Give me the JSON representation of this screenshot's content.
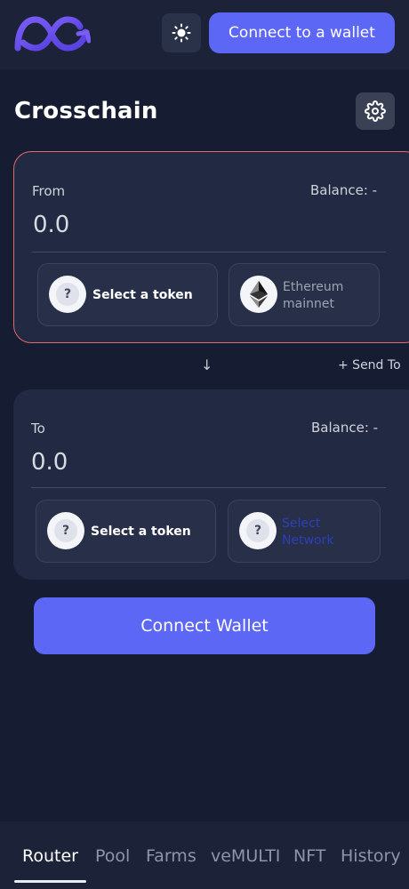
{
  "header": {
    "connect_label": "Connect to a wallet",
    "theme_icon": "sun-icon",
    "accent_color": "#5c67f5"
  },
  "page": {
    "title": "Crosschain",
    "settings_icon": "gear-icon"
  },
  "from": {
    "label": "From",
    "balance": "Balance: -",
    "amount": "0.0",
    "token_label": "Select a token",
    "network_label": "Ethereum mainnet"
  },
  "to": {
    "label": "To",
    "balance": "Balance: -",
    "amount": "0.0",
    "token_label": "Select a token",
    "network_label": "Select Network"
  },
  "swap": {
    "arrow": "↓",
    "send_to": "+ Send To"
  },
  "connect_wallet_label": "Connect Wallet",
  "nav": {
    "items": [
      "Router",
      "Pool",
      "Farms",
      "veMULTI",
      "NFT",
      "History"
    ],
    "active": "Router"
  }
}
